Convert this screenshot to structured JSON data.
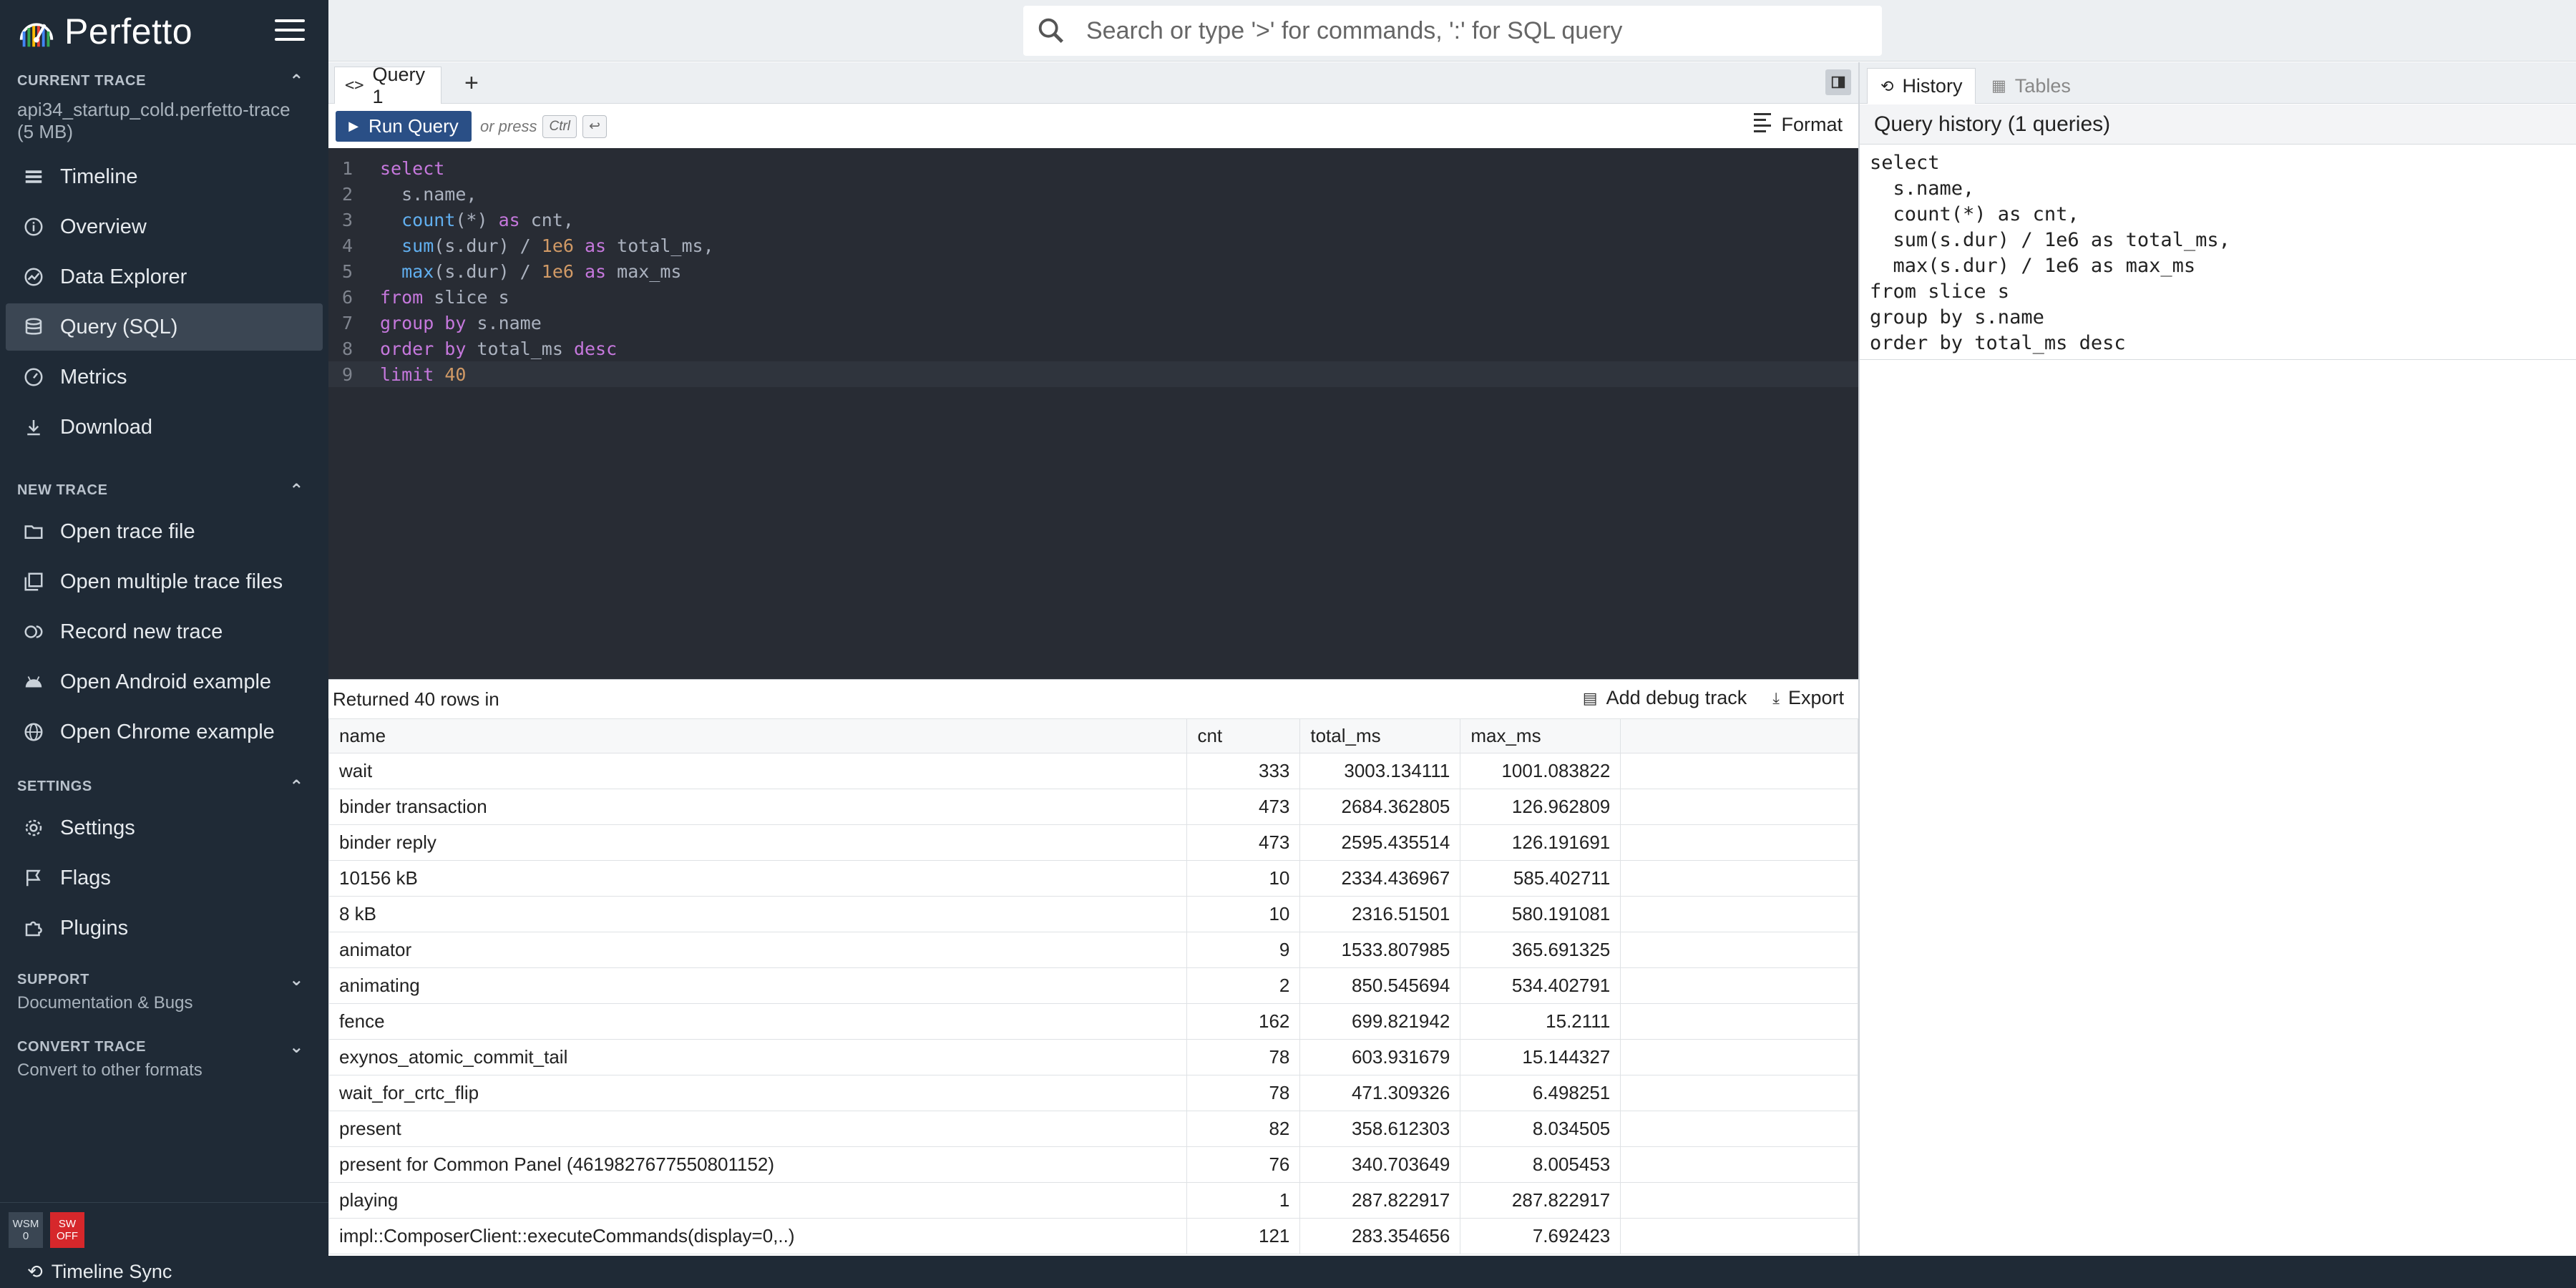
{
  "app": {
    "name": "Perfetto"
  },
  "search": {
    "placeholder": "Search or type '>' for commands, ':' for SQL query"
  },
  "sidebar": {
    "current_trace": {
      "heading": "CURRENT TRACE",
      "trace_name": "api34_startup_cold.perfetto-trace",
      "trace_size": "(5 MB)"
    },
    "items": [
      {
        "label": "Timeline",
        "icon": "timeline-icon"
      },
      {
        "label": "Overview",
        "icon": "info-icon"
      },
      {
        "label": "Data Explorer",
        "icon": "explore-icon"
      },
      {
        "label": "Query (SQL)",
        "icon": "database-icon",
        "active": true
      },
      {
        "label": "Metrics",
        "icon": "speedometer-icon"
      },
      {
        "label": "Download",
        "icon": "download-icon"
      }
    ],
    "new_trace": {
      "heading": "NEW TRACE",
      "items": [
        {
          "label": "Open trace file",
          "icon": "folder-icon"
        },
        {
          "label": "Open multiple trace files",
          "icon": "library-icon"
        },
        {
          "label": "Record new trace",
          "icon": "record-icon"
        },
        {
          "label": "Open Android example",
          "icon": "android-icon"
        },
        {
          "label": "Open Chrome example",
          "icon": "globe-icon"
        }
      ]
    },
    "settings": {
      "heading": "SETTINGS",
      "items": [
        {
          "label": "Settings",
          "icon": "gear-icon"
        },
        {
          "label": "Flags",
          "icon": "flag-icon"
        },
        {
          "label": "Plugins",
          "icon": "puzzle-icon"
        }
      ]
    },
    "support": {
      "heading": "SUPPORT",
      "sub": "Documentation & Bugs"
    },
    "convert_trace": {
      "heading": "CONVERT TRACE",
      "sub": "Convert to other formats"
    },
    "badges": {
      "wsm_top": "WSM",
      "wsm_bottom": "0",
      "sw_top": "SW",
      "sw_bottom": "OFF"
    }
  },
  "status_bar": {
    "label": "Timeline Sync"
  },
  "editor": {
    "tab_label": "Query 1",
    "add_tab": "+",
    "run_label": "Run Query",
    "or_press": "or press",
    "kbd_ctrl": "Ctrl",
    "kbd_enter": "↩",
    "format_label": "Format",
    "lines": [
      "select",
      "  s.name,",
      "  count(*) as cnt,",
      "  sum(s.dur) / 1e6 as total_ms,",
      "  max(s.dur) / 1e6 as max_ms",
      "from slice s",
      "group by s.name",
      "order by total_ms desc",
      "limit 40"
    ]
  },
  "results": {
    "summary": "Returned 40 rows in",
    "add_debug_track": "Add debug track",
    "export": "Export",
    "columns": [
      "name",
      "cnt",
      "total_ms",
      "max_ms"
    ],
    "rows": [
      [
        "wait",
        "333",
        "3003.134111",
        "1001.083822"
      ],
      [
        "binder transaction",
        "473",
        "2684.362805",
        "126.962809"
      ],
      [
        "binder reply",
        "473",
        "2595.435514",
        "126.191691"
      ],
      [
        "10156 kB",
        "10",
        "2334.436967",
        "585.402711"
      ],
      [
        "8 kB",
        "10",
        "2316.51501",
        "580.191081"
      ],
      [
        "animator",
        "9",
        "1533.807985",
        "365.691325"
      ],
      [
        "animating",
        "2",
        "850.545694",
        "534.402791"
      ],
      [
        "fence",
        "162",
        "699.821942",
        "15.2111"
      ],
      [
        "exynos_atomic_commit_tail",
        "78",
        "603.931679",
        "15.144327"
      ],
      [
        "wait_for_crtc_flip",
        "78",
        "471.309326",
        "6.498251"
      ],
      [
        "present",
        "82",
        "358.612303",
        "8.034505"
      ],
      [
        "present for Common Panel (4619827677550801152)",
        "76",
        "340.703649",
        "8.005453"
      ],
      [
        "playing",
        "1",
        "287.822917",
        "287.822917"
      ],
      [
        "impl::ComposerClient::executeCommands(display=0,..)",
        "121",
        "283.354656",
        "7.692423"
      ]
    ]
  },
  "history": {
    "tab_history": "History",
    "tab_tables": "Tables",
    "title": "Query history (1 queries)",
    "entry_lines": [
      "select",
      "  s.name,",
      "  count(*) as cnt,",
      "  sum(s.dur) / 1e6 as total_ms,",
      "  max(s.dur) / 1e6 as max_ms",
      "from slice s",
      "group by s.name",
      "order by total_ms desc"
    ]
  }
}
